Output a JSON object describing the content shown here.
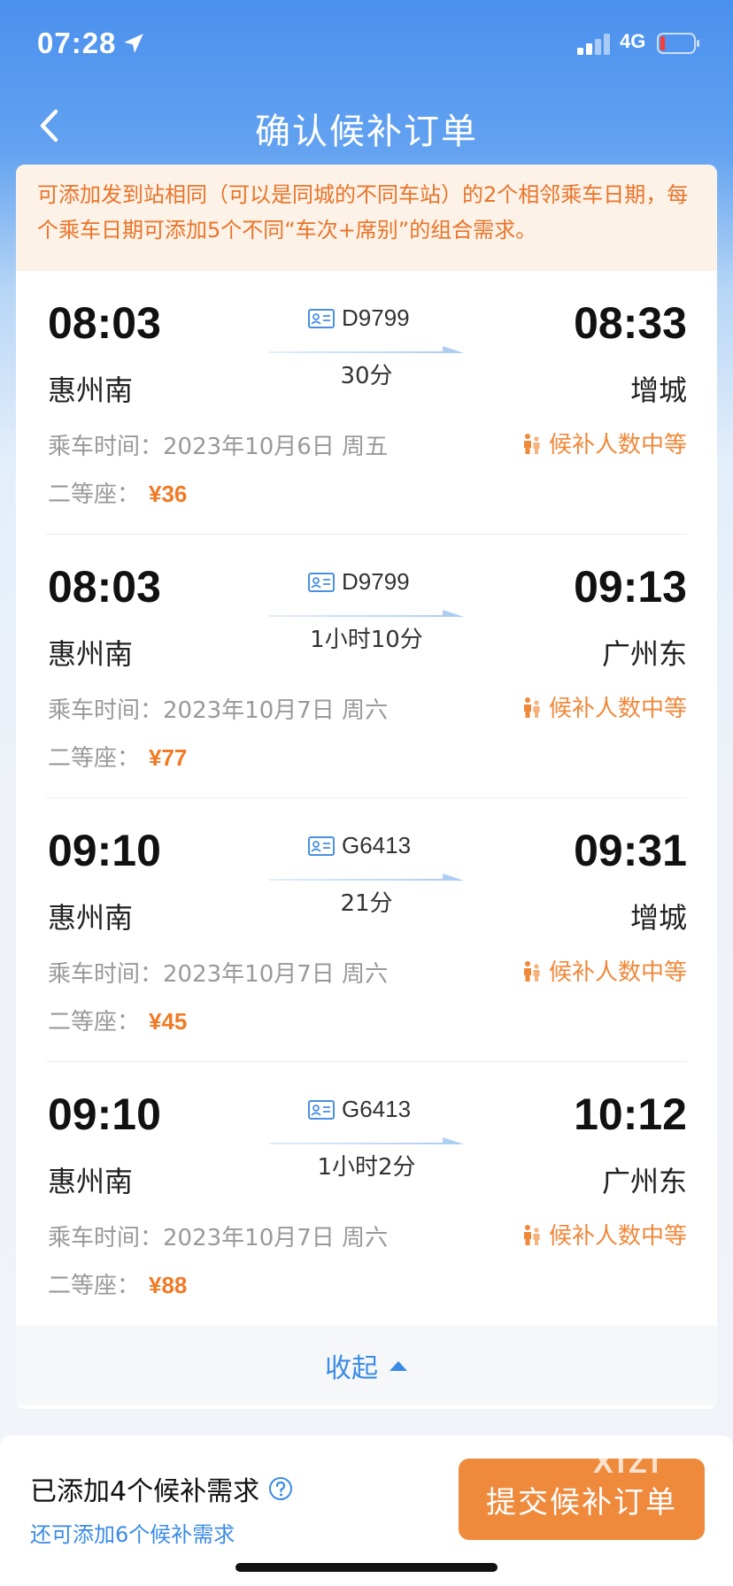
{
  "status_bar": {
    "time": "07:28",
    "network": "4G",
    "icons": [
      "location-arrow-icon",
      "signal-icon",
      "battery-low-icon"
    ]
  },
  "nav": {
    "title": "确认候补订单",
    "back_icon": "chevron-left-icon"
  },
  "notice": "可添加发到站相同（可以是同城的不同车站）的2个相邻乘车日期，每个乘车日期可添加5个不同“车次+席别”的组合需求。",
  "labels": {
    "date_prefix": "乘车时间：",
    "demand": "候补人数中等"
  },
  "trips": [
    {
      "dep_time": "08:03",
      "arr_time": "08:33",
      "dep_station": "惠州南",
      "arr_station": "增城",
      "train": "D9799",
      "duration": "30分",
      "date": "2023年10月6日 周五",
      "seat": "二等座：",
      "price": "¥36"
    },
    {
      "dep_time": "08:03",
      "arr_time": "09:13",
      "dep_station": "惠州南",
      "arr_station": "广州东",
      "train": "D9799",
      "duration": "1小时10分",
      "date": "2023年10月7日 周六",
      "seat": "二等座：",
      "price": "¥77"
    },
    {
      "dep_time": "09:10",
      "arr_time": "09:31",
      "dep_station": "惠州南",
      "arr_station": "增城",
      "train": "G6413",
      "duration": "21分",
      "date": "2023年10月7日 周六",
      "seat": "二等座：",
      "price": "¥45"
    },
    {
      "dep_time": "09:10",
      "arr_time": "10:12",
      "dep_station": "惠州南",
      "arr_station": "广州东",
      "train": "G6413",
      "duration": "1小时2分",
      "date": "2023年10月7日 周六",
      "seat": "二等座：",
      "price": "¥88"
    }
  ],
  "collapse_label": "收起",
  "bottom": {
    "added_text": "已添加4个候补需求",
    "remaining_text": "还可添加6个候补需求",
    "submit_label": "提交候补订单"
  },
  "watermark": "XIZI",
  "colors": {
    "brand_blue": "#4a90ee",
    "accent_orange": "#ef8a3c",
    "link_blue": "#3a8be6"
  }
}
